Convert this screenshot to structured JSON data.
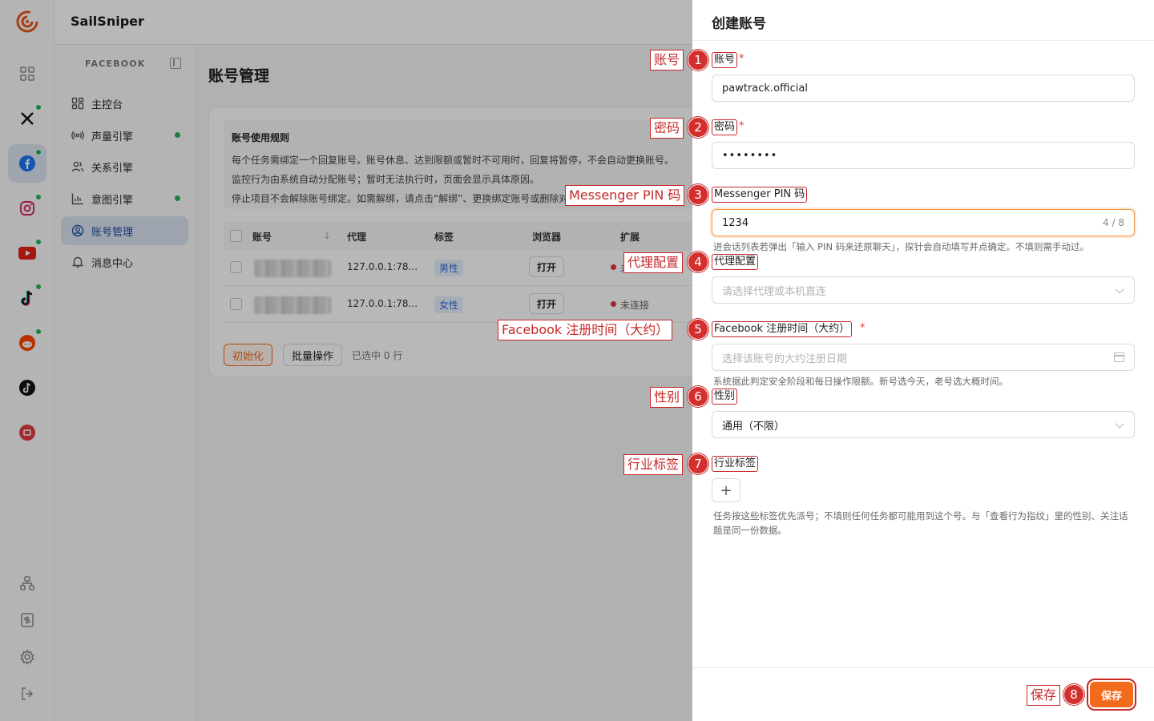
{
  "app": {
    "brand": "SailSniper"
  },
  "rail": {
    "items": [
      {
        "icon": "grid-icon",
        "active": false,
        "dot": false
      },
      {
        "icon": "x-icon",
        "active": false,
        "dot": true
      },
      {
        "icon": "facebook-icon",
        "active": true,
        "dot": true
      },
      {
        "icon": "instagram-icon",
        "active": false,
        "dot": true
      },
      {
        "icon": "youtube-icon",
        "active": false,
        "dot": true
      },
      {
        "icon": "tiktok-icon",
        "active": false,
        "dot": true
      },
      {
        "icon": "reddit-icon",
        "active": false,
        "dot": true
      },
      {
        "icon": "tiktok-dark-icon",
        "active": false,
        "dot": false
      },
      {
        "icon": "xiaohongshu-icon",
        "active": false,
        "dot": false
      }
    ],
    "bottom": [
      "sitemap-icon",
      "billing-icon",
      "gear-icon",
      "logout-icon"
    ]
  },
  "sidenav": {
    "section": "FACEBOOK",
    "items": [
      {
        "label": "主控台",
        "icon": "dashboard-icon",
        "dot": false,
        "active": false
      },
      {
        "label": "声量引擎",
        "icon": "broadcast-icon",
        "dot": true,
        "active": false
      },
      {
        "label": "关系引擎",
        "icon": "users-icon",
        "dot": false,
        "active": false
      },
      {
        "label": "意图引擎",
        "icon": "bar-chart-icon",
        "dot": true,
        "active": false
      },
      {
        "label": "账号管理",
        "icon": "account-icon",
        "dot": false,
        "active": true
      },
      {
        "label": "消息中心",
        "icon": "bell-icon",
        "dot": false,
        "active": false
      }
    ]
  },
  "main": {
    "title": "账号管理",
    "rules": {
      "title": "账号使用规则",
      "lines": [
        "每个任务需绑定一个回复账号。账号休息、达到限额或暂时不可用时，回复将暂停，不会自动更换账号。",
        "监控行为由系统自动分配账号；暂时无法执行时，页面会显示具体原因。",
        "停止项目不会解除账号绑定。如需解绑，请点击“解绑”、更换绑定账号或删除对"
      ]
    },
    "table": {
      "columns": [
        "账号",
        "代理",
        "标签",
        "浏览器",
        "扩展"
      ],
      "rows": [
        {
          "proxy": "127.0.0.1:78...",
          "tag": "男性",
          "browser": "打开",
          "status": "未"
        },
        {
          "proxy": "127.0.0.1:78...",
          "tag": "女性",
          "browser": "打开",
          "status": "未连接"
        }
      ]
    },
    "footer": {
      "init": "初始化",
      "batch": "批量操作",
      "selected": "已选中 0 行"
    }
  },
  "drawer": {
    "title": "创建账号",
    "fields": {
      "account": {
        "label": "账号",
        "value": "pawtrack.official"
      },
      "password": {
        "label": "密码",
        "value": "••••••••"
      },
      "pin": {
        "label": "Messenger PIN 码",
        "value": "1234",
        "count": "4 / 8",
        "hint": "进会话列表若弹出「输入 PIN 码来还原聊天」，探针会自动填写并点确定。不填则需手动过。"
      },
      "proxy": {
        "label": "代理配置",
        "placeholder": "请选择代理或本机直连"
      },
      "regdate": {
        "label": "Facebook 注册时间（大约）",
        "placeholder": "选择该账号的大约注册日期",
        "hint": "系统据此判定安全阶段和每日操作限额。新号选今天，老号选大概时间。"
      },
      "gender": {
        "label": "性别",
        "value": "通用（不限）"
      },
      "tags": {
        "label": "行业标签",
        "add": "+",
        "hint": "任务按这些标签优先派号；不填则任何任务都可能用到这个号。与「查看行为指纹」里的性别、关注话题是同一份数据。"
      }
    },
    "save": "保存"
  },
  "annotations": [
    {
      "num": "1",
      "label": "账号"
    },
    {
      "num": "2",
      "label": "密码"
    },
    {
      "num": "3",
      "label": "Messenger PIN 码"
    },
    {
      "num": "4",
      "label": "代理配置"
    },
    {
      "num": "5",
      "label": "Facebook 注册时间（大约）"
    },
    {
      "num": "6",
      "label": "性别"
    },
    {
      "num": "7",
      "label": "行业标签"
    },
    {
      "num": "8",
      "label": "保存"
    }
  ],
  "colors": {
    "accent": "#f26a1b",
    "annotation": "#c62828",
    "online": "#23b35b",
    "offline": "#e0393e"
  }
}
